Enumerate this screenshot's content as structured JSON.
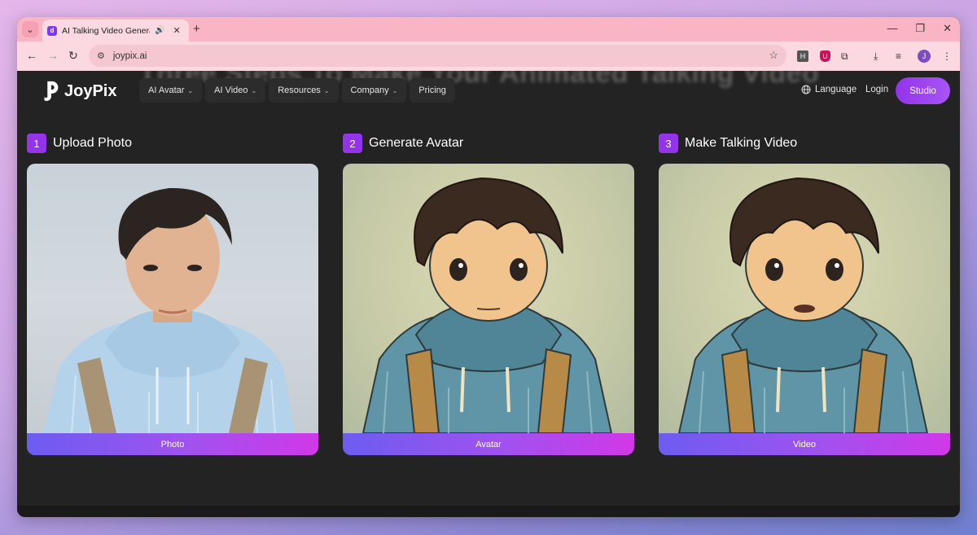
{
  "browser": {
    "tab_title": "AI Talking Video Generator",
    "url": "joypix.ai",
    "profile_initial": "J",
    "ext_h_label": "H"
  },
  "header": {
    "bg_title": "Three Steps To Make Your Animated Talking Video",
    "logo_text": "JoyPix",
    "nav": [
      {
        "label": "AI Avatar"
      },
      {
        "label": "AI Video"
      },
      {
        "label": "Resources"
      },
      {
        "label": "Company"
      },
      {
        "label": "Pricing"
      }
    ],
    "language_label": "Language",
    "login_label": "Login",
    "studio_label": "Studio"
  },
  "steps": [
    {
      "number": "1",
      "title": "Upload Photo",
      "card_label": "Photo"
    },
    {
      "number": "2",
      "title": "Generate Avatar",
      "card_label": "Avatar"
    },
    {
      "number": "3",
      "title": "Make Talking Video",
      "card_label": "Video"
    }
  ],
  "colors": {
    "accent": "#9333ea",
    "page_bg": "#232323",
    "tab_strip": "#f9b5c3"
  }
}
